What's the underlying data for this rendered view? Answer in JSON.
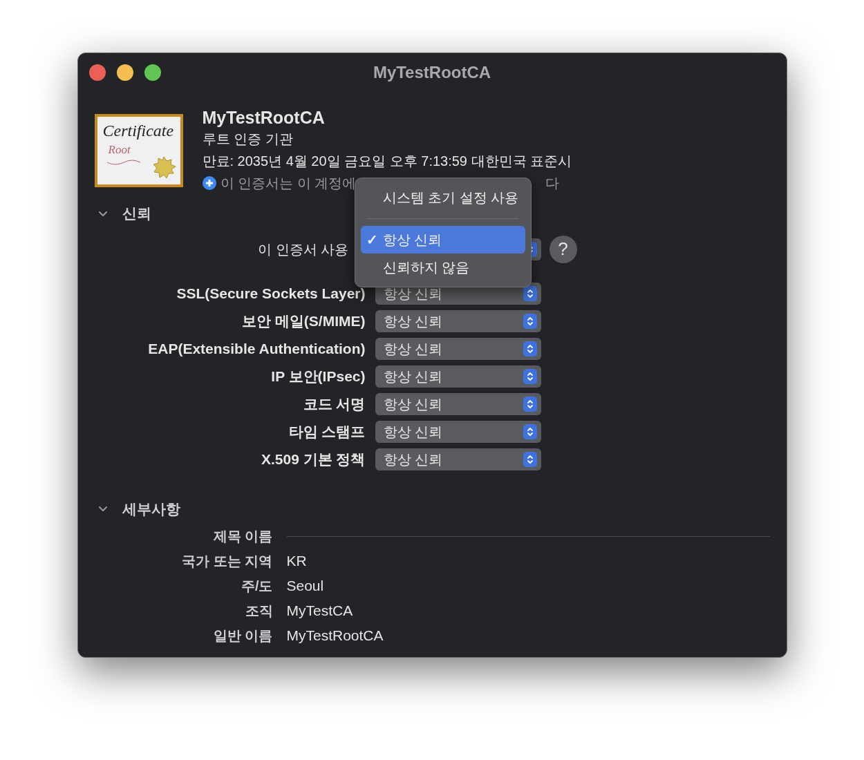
{
  "window": {
    "title": "MyTestRootCA"
  },
  "header": {
    "name": "MyTestRootCA",
    "kind_label": "루트 인증 기관",
    "expires": "만료: 2035년 4월 20일 금요일 오후 7:13:59 대한민국 표준시",
    "note": "이 인증서는 이 계정에",
    "note_tail": "다",
    "icon_title": "Certificate",
    "icon_subtitle": "Root"
  },
  "trust": {
    "title": "신뢰",
    "expanded": true,
    "use_label": "이 인증서 사용",
    "help": "?",
    "menu": {
      "items": [
        {
          "label": "시스템 초기 설정 사용",
          "selected": false
        },
        {
          "label": "항상 신뢰",
          "selected": true
        },
        {
          "label": "신뢰하지 않음",
          "selected": false
        }
      ],
      "check": "✓"
    },
    "rows": [
      {
        "label": "SSL(Secure Sockets Layer)",
        "value": "항상 신뢰"
      },
      {
        "label": "보안 메일(S/MIME)",
        "value": "항상 신뢰"
      },
      {
        "label": "EAP(Extensible Authentication)",
        "value": "항상 신뢰"
      },
      {
        "label": "IP 보안(IPsec)",
        "value": "항상 신뢰"
      },
      {
        "label": "코드 서명",
        "value": "항상 신뢰"
      },
      {
        "label": "타임 스탬프",
        "value": "항상 신뢰"
      },
      {
        "label": "X.509 기본 정책",
        "value": "항상 신뢰"
      }
    ]
  },
  "details": {
    "title": "세부사항",
    "expanded": true,
    "section": "제목 이름",
    "rows": [
      {
        "label": "국가 또는 지역",
        "value": "KR"
      },
      {
        "label": "주/도",
        "value": "Seoul"
      },
      {
        "label": "조직",
        "value": "MyTestCA"
      },
      {
        "label": "일반 이름",
        "value": "MyTestRootCA"
      }
    ]
  }
}
